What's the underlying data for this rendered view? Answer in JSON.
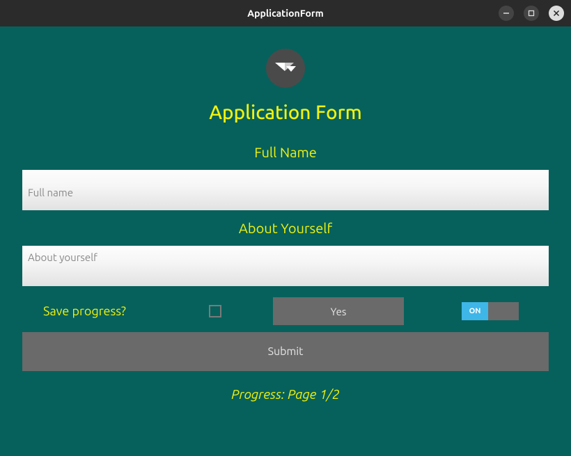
{
  "window": {
    "title": "ApplicationForm"
  },
  "form": {
    "title": "Application Form",
    "fullname_label": "Full Name",
    "fullname_placeholder": "Full name",
    "fullname_value": "",
    "about_label": "About Yourself",
    "about_placeholder": "About yourself",
    "about_value": "",
    "save_progress_label": "Save progress?",
    "yes_button_label": "Yes",
    "switch_on_label": "ON",
    "switch_state": true,
    "submit_label": "Submit",
    "progress_text": "Progress: Page 1/2"
  }
}
